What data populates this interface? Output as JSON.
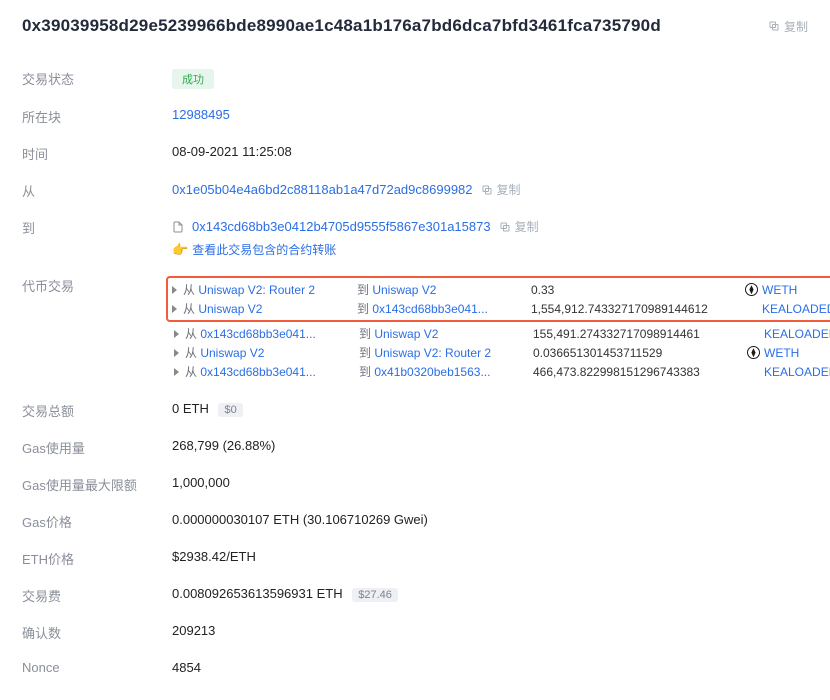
{
  "header": {
    "tx_hash": "0x39039958d29e5239966bde8990ae1c48a1b176a7bd6dca7bfd3461fca735790d",
    "copy_label": "复制"
  },
  "labels": {
    "status": "交易状态",
    "block": "所在块",
    "time": "时间",
    "from": "从",
    "to": "到",
    "token_tx": "代币交易",
    "total": "交易总额",
    "gas_used": "Gas使用量",
    "gas_limit": "Gas使用量最大限额",
    "gas_price": "Gas价格",
    "eth_price": "ETH价格",
    "fee": "交易费",
    "confirmations": "确认数",
    "nonce": "Nonce"
  },
  "values": {
    "status": "成功",
    "block": "12988495",
    "time": "08-09-2021 11:25:08",
    "from": "0x1e05b04e4a6bd2c88118ab1a47d72ad9c8699982",
    "to": "0x143cd68bb3e0412b4705d9555f5867e301a15873",
    "hint": "查看此交易包含的合约转账",
    "total_eth": "0 ETH",
    "total_usd": "$0",
    "gas_used": "268,799 (26.88%)",
    "gas_limit": "1,000,000",
    "gas_price": "0.000000030107 ETH (30.106710269 Gwei)",
    "eth_price": "$2938.42/ETH",
    "fee_eth": "0.008092653613596931 ETH",
    "fee_usd": "$27.46",
    "confirmations": "209213",
    "nonce": "4854"
  },
  "token_tx": {
    "seg_from": "从",
    "seg_to": "到",
    "rows": [
      {
        "hl": true,
        "from": "Uniswap V2: Router 2",
        "to": "Uniswap V2",
        "amount": "0.33",
        "token": "WETH",
        "icon": true
      },
      {
        "hl": true,
        "from": "Uniswap V2",
        "to": "0x143cd68bb3e041...",
        "amount": "1,554,912.743327170989144612",
        "token": "KEALOADED",
        "icon": false
      },
      {
        "hl": false,
        "from": "0x143cd68bb3e041...",
        "to": "Uniswap V2",
        "amount": "155,491.274332717098914461",
        "token": "KEALOADED",
        "icon": false
      },
      {
        "hl": false,
        "from": "Uniswap V2",
        "to": "Uniswap V2: Router 2",
        "amount": "0.036651301453711529",
        "token": "WETH",
        "icon": true
      },
      {
        "hl": false,
        "from": "0x143cd68bb3e041...",
        "to": "0x41b0320beb1563...",
        "amount": "466,473.822998151296743383",
        "token": "KEALOADED",
        "icon": false
      }
    ]
  }
}
